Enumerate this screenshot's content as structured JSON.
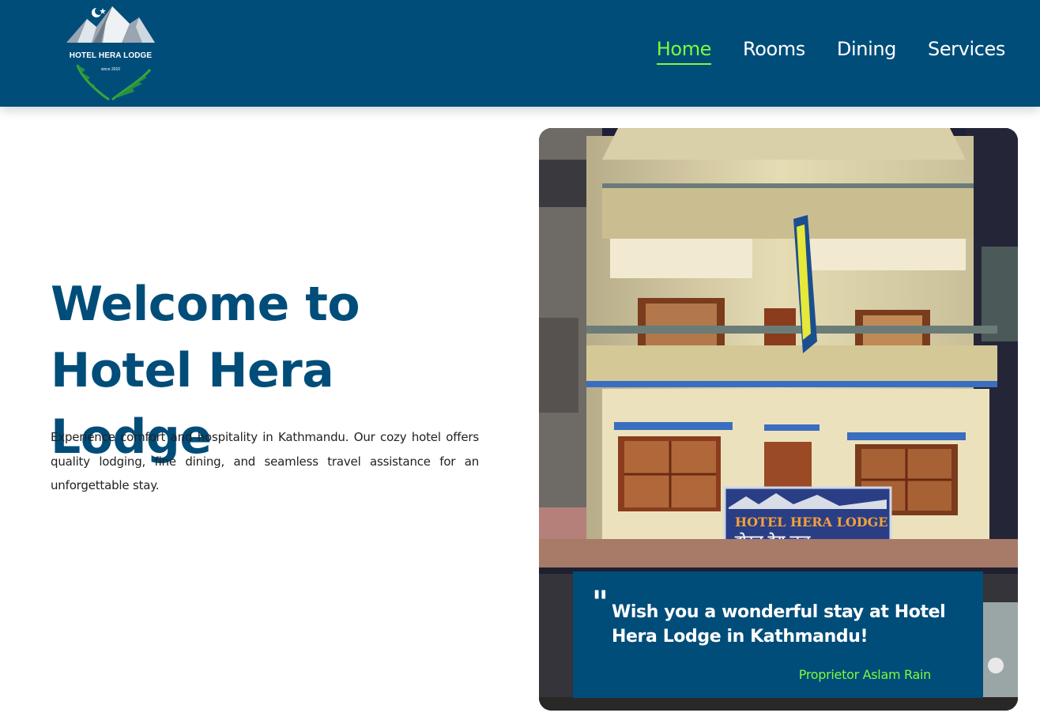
{
  "header": {
    "logo": {
      "name": "HOTEL HERA LODGE",
      "since": "since 2010"
    },
    "nav": [
      {
        "label": "Home",
        "active": true
      },
      {
        "label": "Rooms",
        "active": false
      },
      {
        "label": "Dining",
        "active": false
      },
      {
        "label": "Services",
        "active": false
      }
    ]
  },
  "hero": {
    "title_line1": "Welcome to",
    "title_line2": "Hotel Hera Lodge",
    "description": "Experience comfort and hospitality in Kathmandu. Our cozy hotel offers quality lodging, fine dining, and seamless travel assistance for an unforgettable stay."
  },
  "photo": {
    "sign_english": "HOTEL HERA LODGE",
    "sign_nepali": "होटल हेरा लज"
  },
  "quote": {
    "mark": "\"",
    "text": "Wish you a wonderful stay at Hotel Hera Lodge in Kathmandu!",
    "author": "Proprietor Aslam Rain"
  },
  "colors": {
    "brand_blue": "#004d7a",
    "accent_green": "#7cfc3c"
  }
}
